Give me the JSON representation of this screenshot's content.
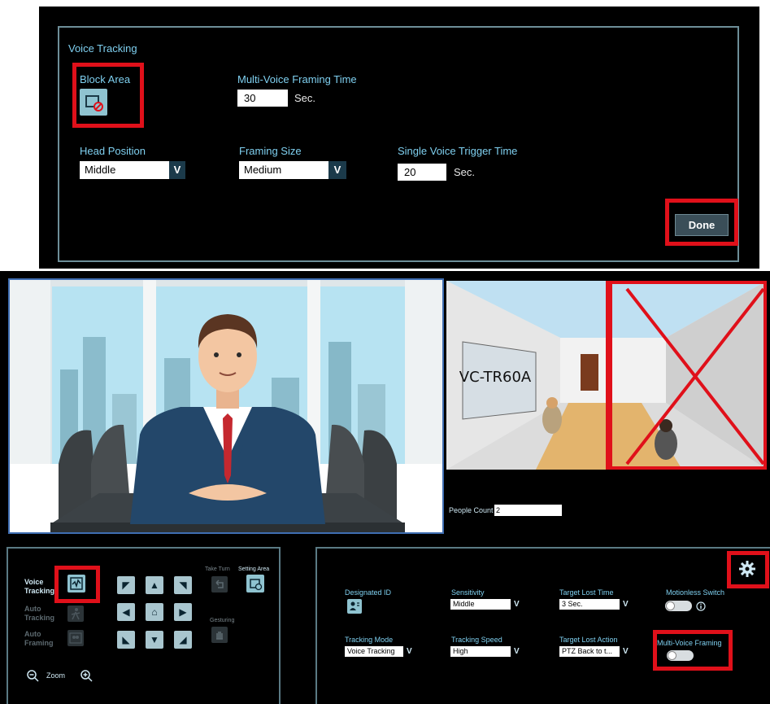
{
  "voice_tracking_panel": {
    "title": "Voice Tracking",
    "block_area_label": "Block Area",
    "multi_voice_framing_time": {
      "label": "Multi-Voice Framing Time",
      "value": "30",
      "unit": "Sec."
    },
    "head_position": {
      "label": "Head Position",
      "value": "Middle"
    },
    "framing_size": {
      "label": "Framing Size",
      "value": "Medium"
    },
    "single_voice_trigger_time": {
      "label": "Single Voice Trigger Time",
      "value": "20",
      "unit": "Sec."
    },
    "done_label": "Done"
  },
  "camera_right": {
    "wall_sign": "VC-TR60A"
  },
  "people_count": {
    "label": "People Count",
    "value": "2"
  },
  "control_panel": {
    "modes": [
      {
        "line1": "Voice",
        "line2": "Tracking",
        "active": true
      },
      {
        "line1": "Auto",
        "line2": "Tracking",
        "active": false
      },
      {
        "line1": "Auto",
        "line2": "Framing",
        "active": false
      }
    ],
    "take_turn_label": "Take Turn",
    "setting_area_label": "Setting Area",
    "gesturing_label": "Gesturing",
    "zoom_label": "Zoom"
  },
  "settings_panel": {
    "designated_id_label": "Designated ID",
    "sensitivity": {
      "label": "Sensitivity",
      "value": "Middle"
    },
    "target_lost_time": {
      "label": "Target Lost Time",
      "value": "3 Sec."
    },
    "motionless_switch_label": "Motionless Switch",
    "tracking_mode": {
      "label": "Tracking Mode",
      "value": "Voice Tracking"
    },
    "tracking_speed": {
      "label": "Tracking Speed",
      "value": "High"
    },
    "target_lost_action": {
      "label": "Target Lost Action",
      "value": "PTZ Back to t..."
    },
    "multi_voice_framing_label": "Multi-Voice Framing"
  },
  "colors": {
    "highlight_red": "#e0101a",
    "label_cyan": "#7fd0f0",
    "panel_border": "#6d8e98"
  }
}
